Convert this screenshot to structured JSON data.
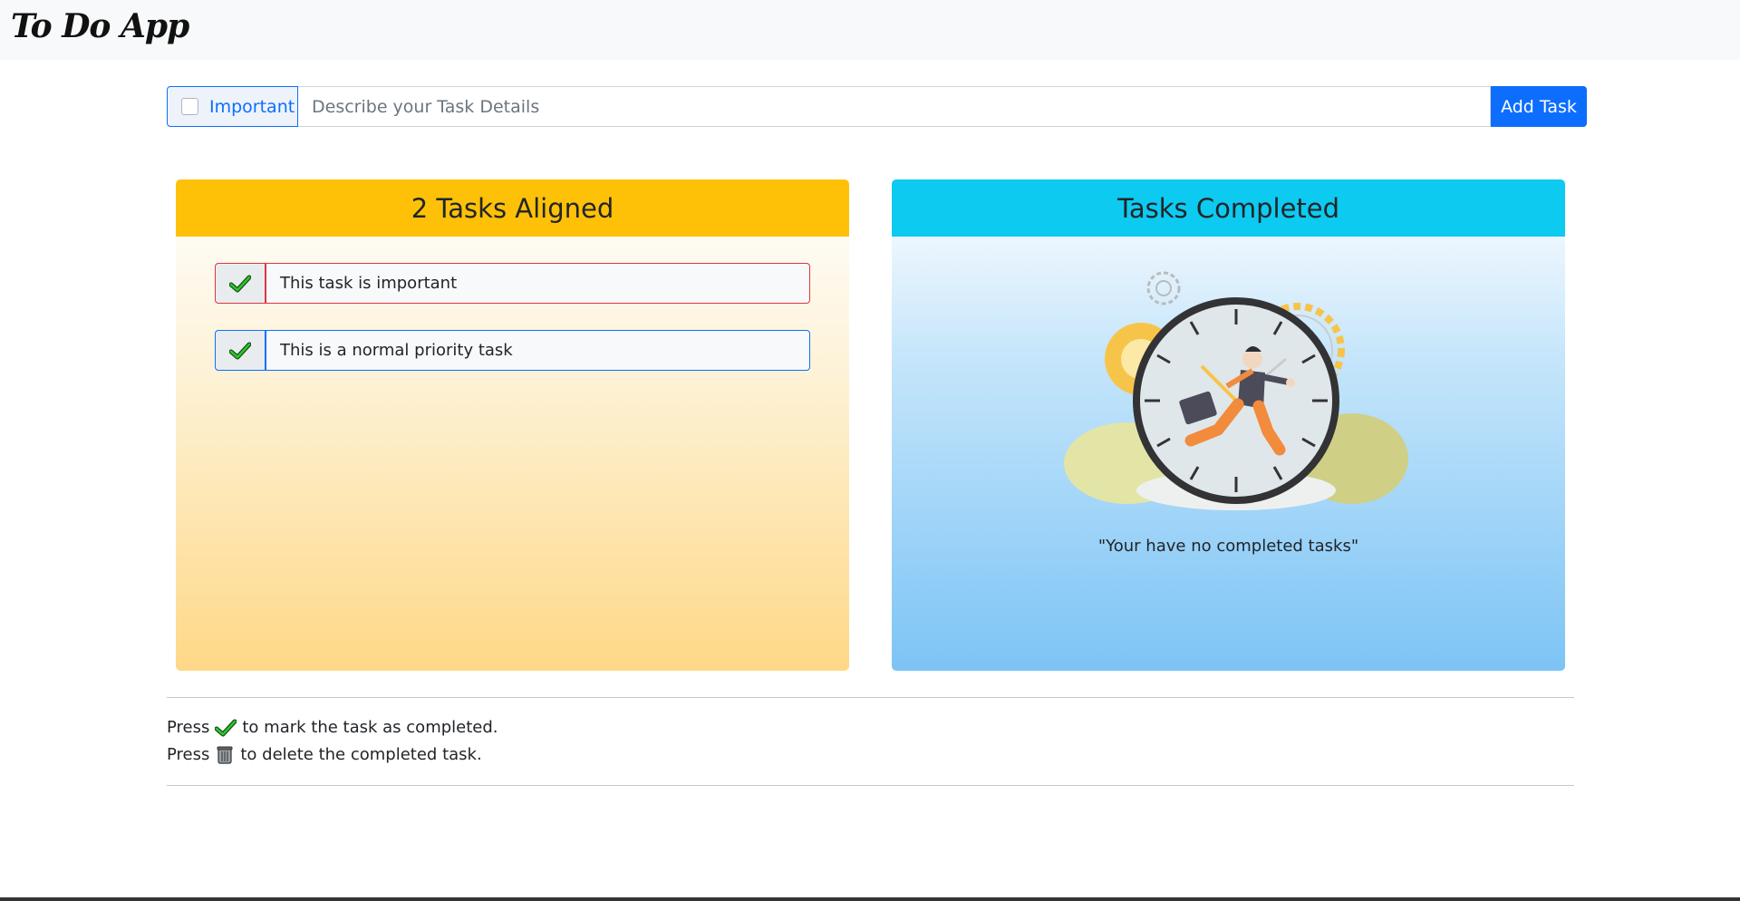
{
  "navbar": {
    "brand": "To Do App"
  },
  "task_form": {
    "important_label": "Important",
    "task_placeholder": "Describe your Task Details",
    "add_button": "Add Task"
  },
  "aligned_panel": {
    "title": "2 Tasks Aligned",
    "tasks": [
      {
        "text": "This task is important",
        "priority": "important"
      },
      {
        "text": "This is a normal priority task",
        "priority": "normal"
      }
    ]
  },
  "completed_panel": {
    "title": "Tasks Completed",
    "empty_message": "\"Your have no completed tasks\""
  },
  "help": {
    "line1_prefix": "Press",
    "line1_suffix": "to mark the task as completed.",
    "line2_prefix": "Press",
    "line2_suffix": "to delete the completed task."
  },
  "colors": {
    "primary": "#0d6efd",
    "warning": "#ffc107",
    "info": "#0dcaf0",
    "danger": "#dc3545"
  },
  "icons": {
    "complete": "checkmark-icon",
    "delete": "trash-can-icon"
  }
}
